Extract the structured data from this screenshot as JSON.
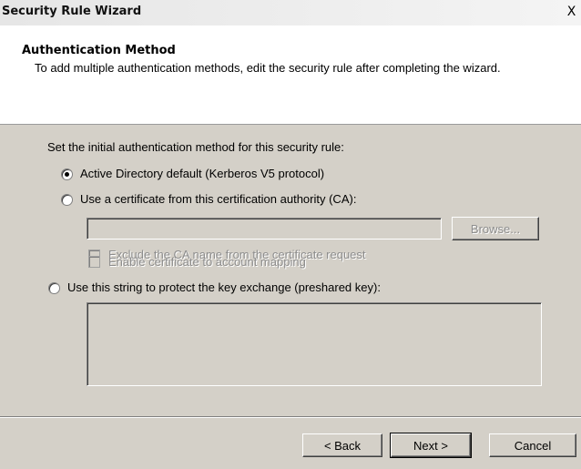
{
  "window": {
    "title": "Security Rule Wizard",
    "close_label": "X"
  },
  "header": {
    "title": "Authentication Method",
    "description": "To add multiple authentication methods, edit the security rule after completing the wizard."
  },
  "main": {
    "intro": "Set the initial authentication method for this security rule:",
    "options": [
      {
        "label": "Active Directory default (Kerberos V5 protocol)",
        "selected": true
      },
      {
        "label": "Use a certificate from this certification authority (CA):",
        "selected": false
      },
      {
        "label": "Use this string to protect the key exchange (preshared key):",
        "selected": false
      }
    ],
    "ca_input": {
      "value": ""
    },
    "browse_label": "Browse...",
    "checkboxes": [
      {
        "label": "Exclude the CA name from the certificate request",
        "checked": false,
        "enabled": false
      },
      {
        "label": "Enable certificate to account mapping",
        "checked": false,
        "enabled": false
      }
    ],
    "preshared_key": {
      "value": ""
    }
  },
  "footer": {
    "back_label": "< Back",
    "next_label": "Next >",
    "cancel_label": "Cancel"
  },
  "icons": [
    "close-icon",
    "scroll-up-arrow-icon",
    "scroll-down-arrow-icon"
  ]
}
